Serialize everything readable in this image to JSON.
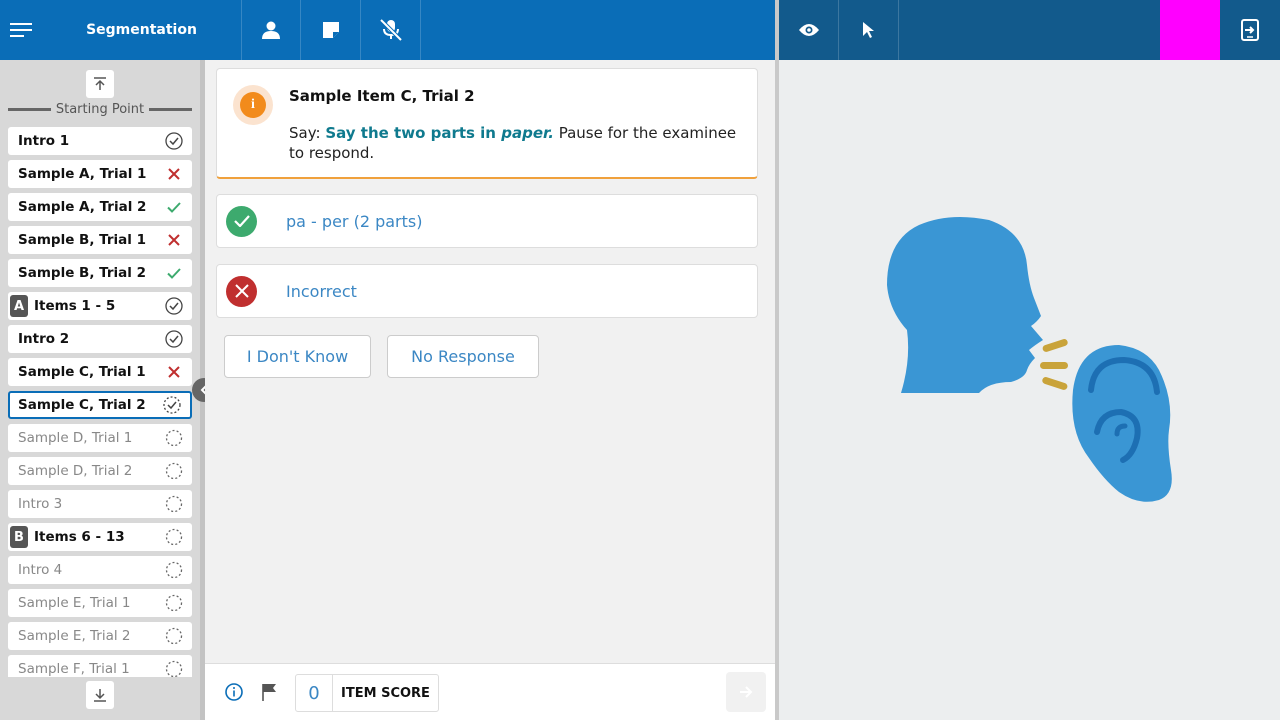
{
  "header": {
    "title": "Segmentation",
    "menu_icon": "hamburger-menu-icon",
    "tools": [
      "person-icon",
      "note-icon",
      "mic-off-icon"
    ],
    "right_tools": [
      "eye-icon",
      "pointer-icon",
      "exit-screen-icon"
    ],
    "accent_color": "#ff00ff"
  },
  "sidebar": {
    "starting_point": "Starting Point",
    "items": [
      {
        "label": "Intro 1",
        "status": "complete",
        "bold": true
      },
      {
        "label": "Sample A, Trial 1",
        "status": "incorrect",
        "bold": true
      },
      {
        "label": "Sample A, Trial 2",
        "status": "correct",
        "bold": true
      },
      {
        "label": "Sample B, Trial 1",
        "status": "incorrect",
        "bold": true
      },
      {
        "label": "Sample B, Trial 2",
        "status": "correct",
        "bold": true
      },
      {
        "label": "Items 1 - 5",
        "status": "complete",
        "bold": true,
        "badge": "A"
      },
      {
        "label": "Intro 2",
        "status": "complete",
        "bold": true
      },
      {
        "label": "Sample C, Trial 1",
        "status": "incorrect",
        "bold": true
      },
      {
        "label": "Sample C, Trial 2",
        "status": "in-progress",
        "bold": true,
        "active": true
      },
      {
        "label": "Sample D, Trial 1",
        "status": "pending",
        "bold": false
      },
      {
        "label": "Sample D, Trial 2",
        "status": "pending",
        "bold": false
      },
      {
        "label": "Intro 3",
        "status": "pending",
        "bold": false
      },
      {
        "label": "Items 6 - 13",
        "status": "pending",
        "bold": true,
        "badge": "B"
      },
      {
        "label": "Intro 4",
        "status": "pending",
        "bold": false
      },
      {
        "label": "Sample E, Trial 1",
        "status": "pending",
        "bold": false
      },
      {
        "label": "Sample E, Trial 2",
        "status": "pending",
        "bold": false
      },
      {
        "label": "Sample F, Trial 1",
        "status": "pending",
        "bold": false
      }
    ]
  },
  "main": {
    "info_title": "Sample Item C, Trial 2",
    "say_prefix": "Say: ",
    "say_text": "Say the two parts in ",
    "say_word": "paper.",
    "instruction": " Pause for the examinee to respond.",
    "options": [
      {
        "label": "pa - per (2 parts)",
        "kind": "correct"
      },
      {
        "label": "Incorrect",
        "kind": "incorrect"
      }
    ],
    "buttons": {
      "dont_know": "I Don't Know",
      "no_response": "No Response"
    }
  },
  "footer": {
    "score": "0",
    "score_label": "ITEM SCORE"
  },
  "colors": {
    "primary": "#0a6db7",
    "correct": "#3daa6e",
    "incorrect": "#c02f2f",
    "illustration": "#3a96d4"
  }
}
